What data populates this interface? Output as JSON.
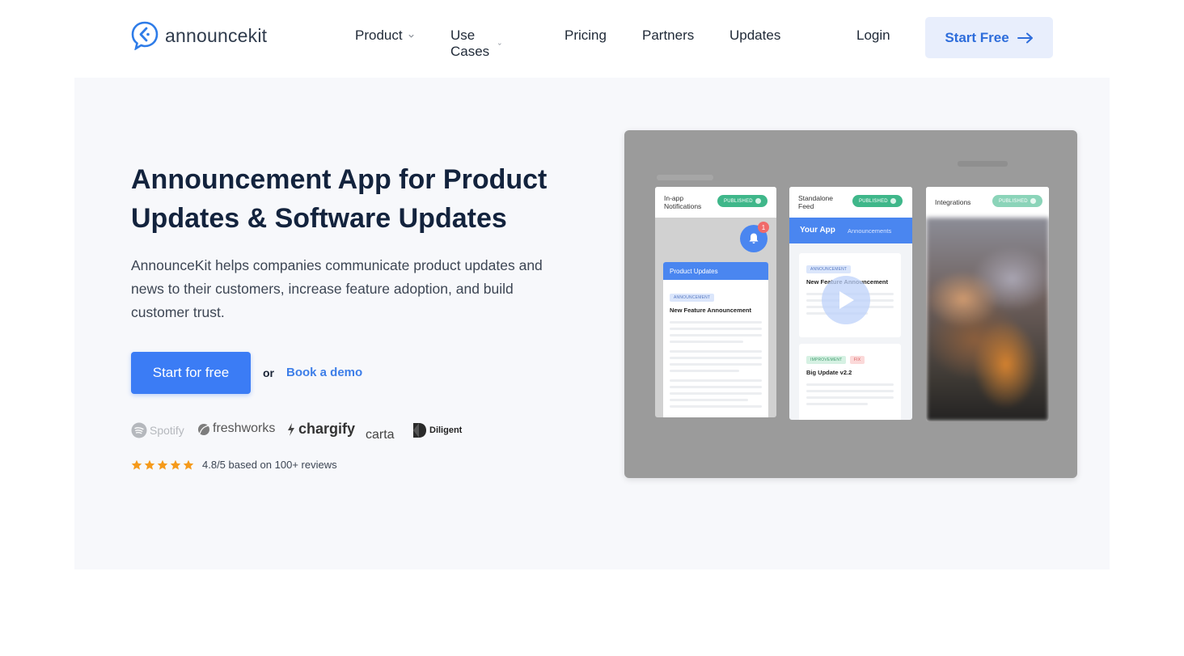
{
  "brand": {
    "name": "announcekit",
    "accent": "#3b7cf5"
  },
  "nav": {
    "product": "Product",
    "use_cases": "Use Cases",
    "pricing": "Pricing",
    "partners": "Partners",
    "updates": "Updates",
    "login": "Login",
    "start_free": "Start Free"
  },
  "hero": {
    "title": "Announcement App for Product Updates & Software Updates",
    "description": "AnnounceKit helps companies communicate product updates and news to their customers, increase feature adoption, and build customer trust.",
    "cta_primary": "Start for free",
    "cta_or": "or",
    "cta_demo": "Book a demo",
    "customer_logos": [
      "Spotify",
      "freshworks",
      "chargify",
      "carta",
      "Diligent"
    ],
    "rating": {
      "stars": 5,
      "text": "4.8/5 based on 100+ reviews"
    }
  },
  "preview": {
    "card_inapp": {
      "label": "In-app Notifications",
      "badge": "PUBLISHED",
      "notification_count": "1",
      "panel_title": "Product Updates",
      "tag": "ANNOUNCEMENT",
      "item_title": "New Feature Announcement"
    },
    "card_feed": {
      "label": "Standalone Feed",
      "badge": "PUBLISHED",
      "app_title": "Your App",
      "app_subtitle": "Announcements",
      "post1_tag": "ANNOUNCEMENT",
      "post1_title": "New Feature Announcement",
      "post2_tag1": "IMPROVEMENT",
      "post2_tag2": "FIX",
      "post2_title": "Big Update v2.2"
    },
    "card_integrations": {
      "label": "Integrations",
      "badge": "PUBLISHED"
    }
  }
}
